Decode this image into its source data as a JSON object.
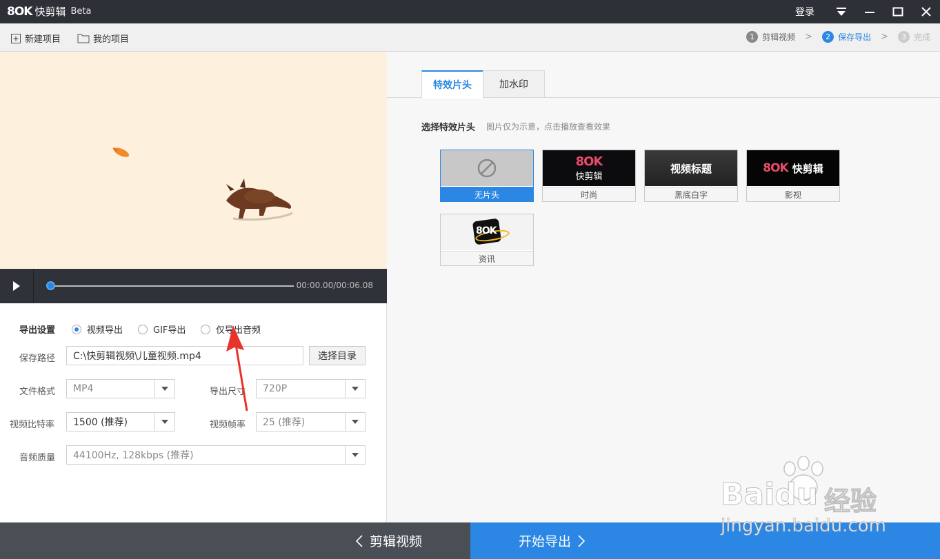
{
  "app": {
    "logo_mark": "8OK",
    "name": "快剪辑",
    "badge": "Beta",
    "login_label": "登录"
  },
  "toolbar": {
    "new_project": "新建项目",
    "my_projects": "我的项目"
  },
  "steps": [
    {
      "num": "1",
      "label": "剪辑视频",
      "state": "done"
    },
    {
      "num": "2",
      "label": "保存导出",
      "state": "active"
    },
    {
      "num": "3",
      "label": "完成",
      "state": "disabled"
    }
  ],
  "player": {
    "time": "00:00.00/00:06.08",
    "progress": 0
  },
  "export": {
    "title": "导出设置",
    "modes": [
      {
        "label": "视频导出",
        "checked": true
      },
      {
        "label": "GIF导出",
        "checked": false
      },
      {
        "label": "仅导出音频",
        "checked": false
      }
    ],
    "save_path_label": "保存路径",
    "save_path_value": "C:\\快剪辑视频\\儿童视频.mp4",
    "choose_dir": "选择目录",
    "format_label": "文件格式",
    "format_value": "MP4",
    "size_label": "导出尺寸",
    "size_value": "720P",
    "bitrate_label": "视频比特率",
    "bitrate_value": "1500 (推荐)",
    "framerate_label": "视频帧率",
    "framerate_value": "25 (推荐)",
    "audio_label": "音频质量",
    "audio_value": "44100Hz, 128kbps (推荐)"
  },
  "right": {
    "tabs": [
      "特效片头",
      "加水印"
    ],
    "section_title": "选择特效片头",
    "section_hint": "图片仅为示意，点击播放查看效果",
    "cards": [
      {
        "caption": "无片头",
        "selected": true
      },
      {
        "caption": "时尚",
        "thumb_text": "快剪辑",
        "thumb_mark": "8OK"
      },
      {
        "caption": "黑底白字",
        "thumb_text": "视频标题"
      },
      {
        "caption": "影视",
        "thumb_text": "快剪辑",
        "thumb_mark": "8OK"
      },
      {
        "caption": "资讯",
        "thumb_mark": "8OK"
      }
    ]
  },
  "bottom": {
    "back": "剪辑视频",
    "export": "开始导出"
  },
  "watermark": {
    "brand": "Baidu",
    "cn": "经验",
    "url": "jingyan.baidu.com"
  },
  "colors": {
    "accent": "#2b87e3",
    "titlebar": "#2d3036",
    "bottombar": "#4a4f56",
    "preview_bg": "#fdf0dc"
  }
}
